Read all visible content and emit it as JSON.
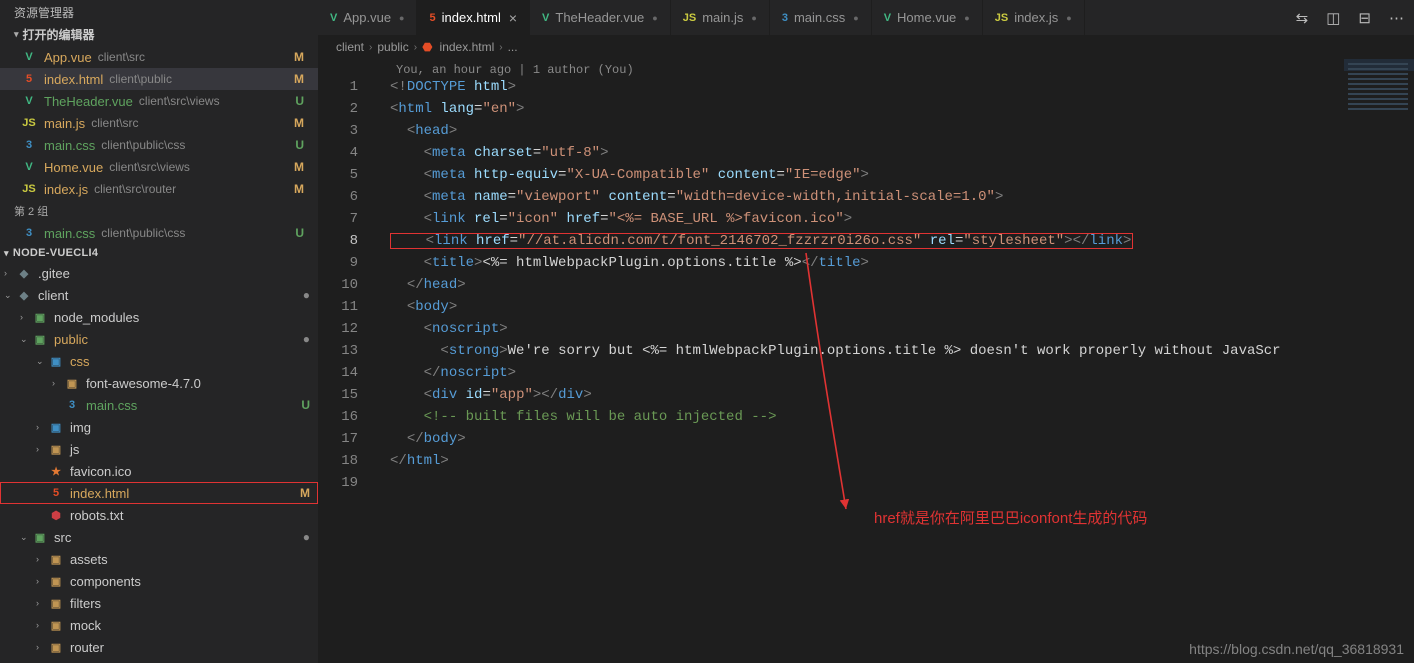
{
  "sidebar": {
    "explorer_label": "资源管理器",
    "open_editors_label": "打开的编辑器",
    "group_label": "第 2 组",
    "open_editors_1": [
      {
        "icon": "V",
        "iconClass": "ic-vue",
        "name": "App.vue",
        "path": "client\\src",
        "status": "M",
        "mod": true
      },
      {
        "icon": "5",
        "iconClass": "ic-html",
        "name": "index.html",
        "path": "client\\public",
        "status": "M",
        "mod": true,
        "active": true
      },
      {
        "icon": "V",
        "iconClass": "ic-vue",
        "name": "TheHeader.vue",
        "path": "client\\src\\views",
        "status": "U",
        "unt": true
      },
      {
        "icon": "JS",
        "iconClass": "ic-js",
        "name": "main.js",
        "path": "client\\src",
        "status": "M",
        "mod": true
      },
      {
        "icon": "3",
        "iconClass": "ic-css",
        "name": "main.css",
        "path": "client\\public\\css",
        "status": "U",
        "unt": true
      },
      {
        "icon": "V",
        "iconClass": "ic-vue",
        "name": "Home.vue",
        "path": "client\\src\\views",
        "status": "M",
        "mod": true
      },
      {
        "icon": "JS",
        "iconClass": "ic-js",
        "name": "index.js",
        "path": "client\\src\\router",
        "status": "M",
        "mod": true
      }
    ],
    "open_editors_2": [
      {
        "icon": "3",
        "iconClass": "ic-css",
        "name": "main.css",
        "path": "client\\public\\css",
        "status": "U",
        "unt": true
      }
    ],
    "project": "NODE-VUECLI4",
    "tree": [
      {
        "indent": 0,
        "chev": "›",
        "icon": "◆",
        "iconClass": "ic-grey",
        "name": ".gitee"
      },
      {
        "indent": 0,
        "chev": "⌄",
        "icon": "◆",
        "iconClass": "ic-grey",
        "name": "client",
        "status": "●",
        "statusClass": "dot"
      },
      {
        "indent": 1,
        "chev": "›",
        "icon": "▣",
        "iconClass": "folder-icon nm",
        "name": "node_modules"
      },
      {
        "indent": 1,
        "chev": "⌄",
        "icon": "▣",
        "iconClass": "folder-icon public",
        "name": "public",
        "status": "●",
        "statusClass": "dot",
        "mod": true
      },
      {
        "indent": 2,
        "chev": "⌄",
        "icon": "▣",
        "iconClass": "folder-icon css",
        "name": "css",
        "mod": true
      },
      {
        "indent": 3,
        "chev": "›",
        "icon": "▣",
        "iconClass": "folder-icon",
        "name": "font-awesome-4.7.0"
      },
      {
        "indent": 3,
        "chev": "",
        "icon": "3",
        "iconClass": "ic-css",
        "name": "main.css",
        "status": "U",
        "unt": true
      },
      {
        "indent": 2,
        "chev": "›",
        "icon": "▣",
        "iconClass": "folder-icon img",
        "name": "img"
      },
      {
        "indent": 2,
        "chev": "›",
        "icon": "▣",
        "iconClass": "folder-icon",
        "name": "js"
      },
      {
        "indent": 2,
        "chev": "",
        "icon": "★",
        "iconClass": "ic-orange",
        "name": "favicon.ico"
      },
      {
        "indent": 2,
        "chev": "",
        "icon": "5",
        "iconClass": "ic-html",
        "name": "index.html",
        "status": "M",
        "mod": true,
        "boxsel": true
      },
      {
        "indent": 2,
        "chev": "",
        "icon": "⬢",
        "iconClass": "ic-red",
        "name": "robots.txt"
      },
      {
        "indent": 1,
        "chev": "⌄",
        "icon": "▣",
        "iconClass": "folder-icon src",
        "name": "src",
        "status": "●",
        "statusClass": "dot"
      },
      {
        "indent": 2,
        "chev": "›",
        "icon": "▣",
        "iconClass": "folder-icon",
        "name": "assets"
      },
      {
        "indent": 2,
        "chev": "›",
        "icon": "▣",
        "iconClass": "folder-icon",
        "name": "components"
      },
      {
        "indent": 2,
        "chev": "›",
        "icon": "▣",
        "iconClass": "folder-icon",
        "name": "filters"
      },
      {
        "indent": 2,
        "chev": "›",
        "icon": "▣",
        "iconClass": "folder-icon",
        "name": "mock"
      },
      {
        "indent": 2,
        "chev": "›",
        "icon": "▣",
        "iconClass": "folder-icon",
        "name": "router"
      }
    ]
  },
  "tabs": [
    {
      "icon": "V",
      "iconClass": "ic-vue",
      "name": "App.vue",
      "dirty": true
    },
    {
      "icon": "5",
      "iconClass": "ic-html",
      "name": "index.html",
      "active": true,
      "close": true
    },
    {
      "icon": "V",
      "iconClass": "ic-vue",
      "name": "TheHeader.vue",
      "dirty": true
    },
    {
      "icon": "JS",
      "iconClass": "ic-js",
      "name": "main.js",
      "dirty": true
    },
    {
      "icon": "3",
      "iconClass": "ic-css",
      "name": "main.css",
      "dirty": true
    },
    {
      "icon": "V",
      "iconClass": "ic-vue",
      "name": "Home.vue",
      "dirty": true
    },
    {
      "icon": "JS",
      "iconClass": "ic-js",
      "name": "index.js",
      "dirty": true
    }
  ],
  "breadcrumbs": {
    "parts": [
      "client",
      "public",
      "index.html"
    ],
    "tail": "..."
  },
  "gitlens": "You, an hour ago | 1 author (You)",
  "code": [
    {
      "n": 1,
      "html": "<span class='t-angle'>&lt;!</span><span class='t-doctype'>DOCTYPE</span> <span class='t-attr'>html</span><span class='t-angle'>&gt;</span>"
    },
    {
      "n": 2,
      "html": "<span class='t-angle'>&lt;</span><span class='t-tag'>html</span> <span class='t-attr'>lang</span>=<span class='t-str'>\"en\"</span><span class='t-angle'>&gt;</span>"
    },
    {
      "n": 3,
      "html": "  <span class='t-angle'>&lt;</span><span class='t-tag'>head</span><span class='t-angle'>&gt;</span>"
    },
    {
      "n": 4,
      "html": "    <span class='t-angle'>&lt;</span><span class='t-tag'>meta</span> <span class='t-attr'>charset</span>=<span class='t-str'>\"utf-8\"</span><span class='t-angle'>&gt;</span>"
    },
    {
      "n": 5,
      "html": "    <span class='t-angle'>&lt;</span><span class='t-tag'>meta</span> <span class='t-attr'>http-equiv</span>=<span class='t-str'>\"X-UA-Compatible\"</span> <span class='t-attr'>content</span>=<span class='t-str'>\"IE=edge\"</span><span class='t-angle'>&gt;</span>"
    },
    {
      "n": 6,
      "html": "    <span class='t-angle'>&lt;</span><span class='t-tag'>meta</span> <span class='t-attr'>name</span>=<span class='t-str'>\"viewport\"</span> <span class='t-attr'>content</span>=<span class='t-str'>\"width=device-width,initial-scale=1.0\"</span><span class='t-angle'>&gt;</span>"
    },
    {
      "n": 7,
      "html": "    <span class='t-angle'>&lt;</span><span class='t-tag'>link</span> <span class='t-attr'>rel</span>=<span class='t-str'>\"icon\"</span> <span class='t-attr'>href</span>=<span class='t-str'>\"&lt;%= BASE_URL %&gt;favicon.ico\"</span><span class='t-angle'>&gt;</span>"
    },
    {
      "n": 8,
      "cur": true,
      "add": true,
      "box": true,
      "html": "    <span class='t-angle'>&lt;</span><span class='t-tag'>link</span> <span class='t-attr'>href</span>=<span class='t-str'>\"//at.alicdn.com/t/font_2146702_fzzrzr0i26o.css\"</span> <span class='t-attr'>rel</span>=<span class='t-str'>\"stylesheet\"</span><span class='t-angle'>&gt;&lt;/</span><span class='t-tag'>link</span><span class='t-angle'>&gt;</span>"
    },
    {
      "n": 9,
      "html": "    <span class='t-angle'>&lt;</span><span class='t-tag'>title</span><span class='t-angle'>&gt;</span><span class='t-txt'>&lt;%= htmlWebpackPlugin.options.title %&gt;</span><span class='t-angle'>&lt;/</span><span class='t-tag'>title</span><span class='t-angle'>&gt;</span>"
    },
    {
      "n": 10,
      "html": "  <span class='t-angle'>&lt;/</span><span class='t-tag'>head</span><span class='t-angle'>&gt;</span>"
    },
    {
      "n": 11,
      "html": "  <span class='t-angle'>&lt;</span><span class='t-tag'>body</span><span class='t-angle'>&gt;</span>"
    },
    {
      "n": 12,
      "html": "    <span class='t-angle'>&lt;</span><span class='t-tag'>noscript</span><span class='t-angle'>&gt;</span>"
    },
    {
      "n": 13,
      "html": "      <span class='t-angle'>&lt;</span><span class='t-tag'>strong</span><span class='t-angle'>&gt;</span><span class='t-txt'>We're sorry but &lt;%= htmlWebpackPlugin.options.title %&gt; doesn't work properly without JavaScr</span>"
    },
    {
      "n": 14,
      "html": "    <span class='t-angle'>&lt;/</span><span class='t-tag'>noscript</span><span class='t-angle'>&gt;</span>"
    },
    {
      "n": 15,
      "html": "    <span class='t-angle'>&lt;</span><span class='t-tag'>div</span> <span class='t-attr'>id</span>=<span class='t-str'>\"app\"</span><span class='t-angle'>&gt;&lt;/</span><span class='t-tag'>div</span><span class='t-angle'>&gt;</span>"
    },
    {
      "n": 16,
      "html": "    <span class='t-comment'>&lt;!-- built files will be auto injected --&gt;</span>"
    },
    {
      "n": 17,
      "html": "  <span class='t-angle'>&lt;/</span><span class='t-tag'>body</span><span class='t-angle'>&gt;</span>"
    },
    {
      "n": 18,
      "html": "<span class='t-angle'>&lt;/</span><span class='t-tag'>html</span><span class='t-angle'>&gt;</span>"
    },
    {
      "n": 19,
      "html": ""
    }
  ],
  "annotation": "href就是你在阿里巴巴iconfont生成的代码",
  "watermark": "https://blog.csdn.net/qq_36818931"
}
